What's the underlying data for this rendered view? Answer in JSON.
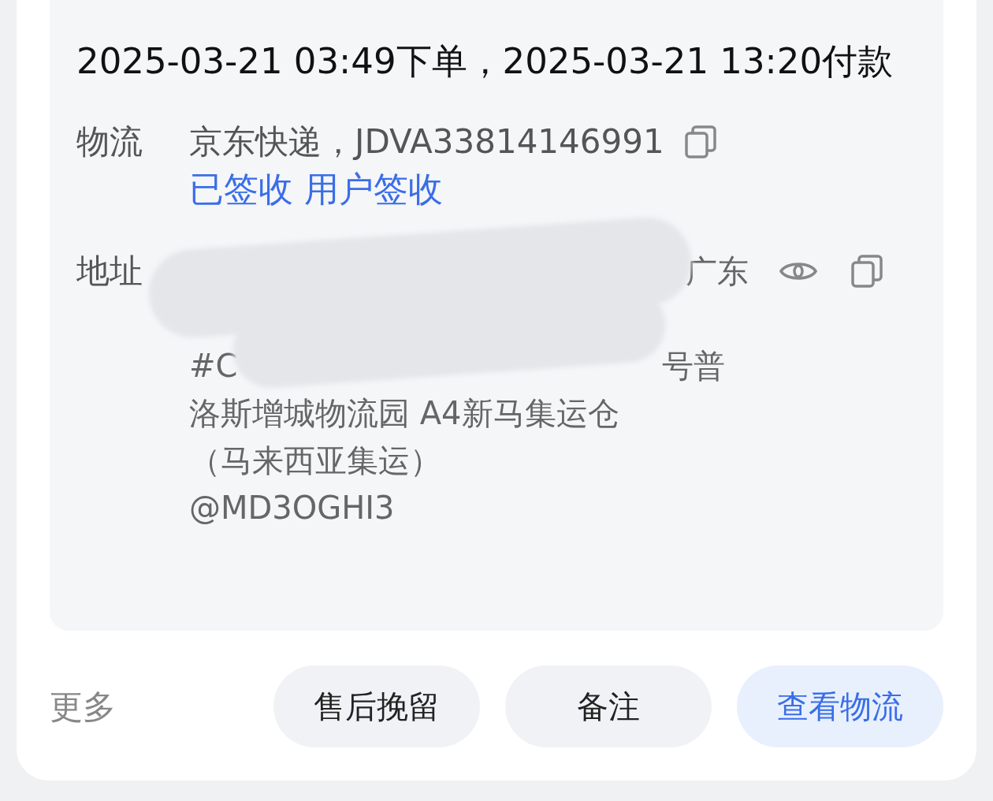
{
  "order_time": "2025-03-21 03:49下单，2025-03-21 13:20付款",
  "logistics": {
    "label": "物流",
    "carrier": "京东快递，JDVA33814146991",
    "status": "已签收 用户签收"
  },
  "address": {
    "label": "地址",
    "redacted": true,
    "lines": [
      {
        "kind": "end",
        "parts": [
          "广东"
        ]
      },
      {
        "kind": "split",
        "parts": [
          "#C",
          "号普"
        ]
      },
      {
        "kind": "plain",
        "parts": [
          "洛斯增城物流园 A4新马集运仓"
        ]
      },
      {
        "kind": "plain",
        "parts": [
          "（马来西亚集运）"
        ]
      },
      {
        "kind": "plain",
        "parts": [
          "@MD3OGHI3"
        ]
      }
    ]
  },
  "more": "更多",
  "buttons": [
    {
      "label": "售后挽留",
      "kind": "plain"
    },
    {
      "label": "备注",
      "kind": "plain"
    },
    {
      "label": "查看物流",
      "kind": "primary"
    }
  ]
}
